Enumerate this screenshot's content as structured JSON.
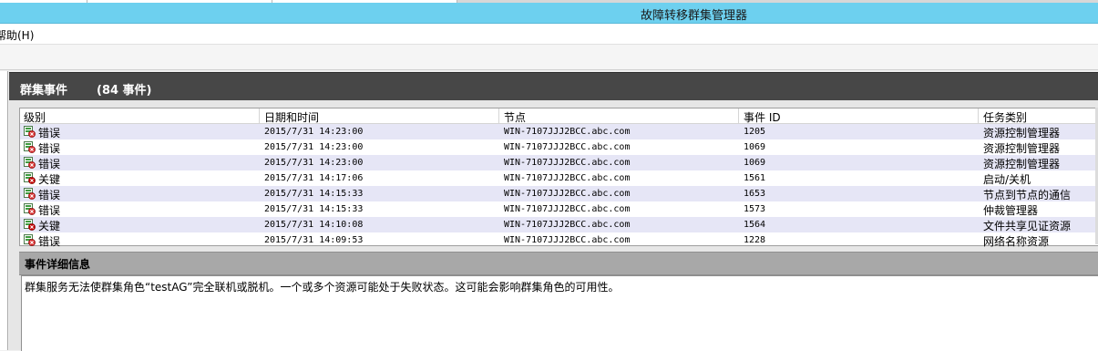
{
  "window": {
    "title": "故障转移群集管理器"
  },
  "menu": {
    "help": "帮助(H)"
  },
  "events_panel": {
    "title": "群集事件",
    "count": "(84 事件)"
  },
  "table": {
    "columns": [
      "级别",
      "日期和时间",
      "节点",
      "事件 ID",
      "任务类别"
    ],
    "rows": [
      {
        "level": "错误",
        "datetime": "2015/7/31 14:23:00",
        "node": "WIN-7107JJJ2BCC.abc.com",
        "event_id": "1205",
        "task": "资源控制管理器",
        "icon": "error-icon"
      },
      {
        "level": "错误",
        "datetime": "2015/7/31 14:23:00",
        "node": "WIN-7107JJJ2BCC.abc.com",
        "event_id": "1069",
        "task": "资源控制管理器",
        "icon": "error-icon"
      },
      {
        "level": "错误",
        "datetime": "2015/7/31 14:23:00",
        "node": "WIN-7107JJJ2BCC.abc.com",
        "event_id": "1069",
        "task": "资源控制管理器",
        "icon": "error-icon"
      },
      {
        "level": "关键",
        "datetime": "2015/7/31 14:17:06",
        "node": "WIN-7107JJJ2BCC.abc.com",
        "event_id": "1561",
        "task": "启动/关机",
        "icon": "critical-icon"
      },
      {
        "level": "错误",
        "datetime": "2015/7/31 14:15:33",
        "node": "WIN-7107JJJ2BCC.abc.com",
        "event_id": "1653",
        "task": "节点到节点的通信",
        "icon": "error-icon"
      },
      {
        "level": "错误",
        "datetime": "2015/7/31 14:15:33",
        "node": "WIN-7107JJJ2BCC.abc.com",
        "event_id": "1573",
        "task": "仲裁管理器",
        "icon": "error-icon"
      },
      {
        "level": "关键",
        "datetime": "2015/7/31 14:10:08",
        "node": "WIN-7107JJJ2BCC.abc.com",
        "event_id": "1564",
        "task": "文件共享见证资源",
        "icon": "critical-icon"
      },
      {
        "level": "错误",
        "datetime": "2015/7/31 14:09:53",
        "node": "WIN-7107JJJ2BCC.abc.com",
        "event_id": "1228",
        "task": "网络名称资源",
        "icon": "error-icon"
      }
    ]
  },
  "details": {
    "title": "事件详细信息",
    "message": "群集服务无法使群集角色“testAG”完全联机或脱机。一个或多个资源可能处于失败状态。这可能会影响群集角色的可用性。"
  },
  "colors": {
    "title_bar": "#6dd0ef",
    "header_band": "#474747",
    "row_alt": "#e6e6f6",
    "detail_header": "#a8a8a8"
  }
}
